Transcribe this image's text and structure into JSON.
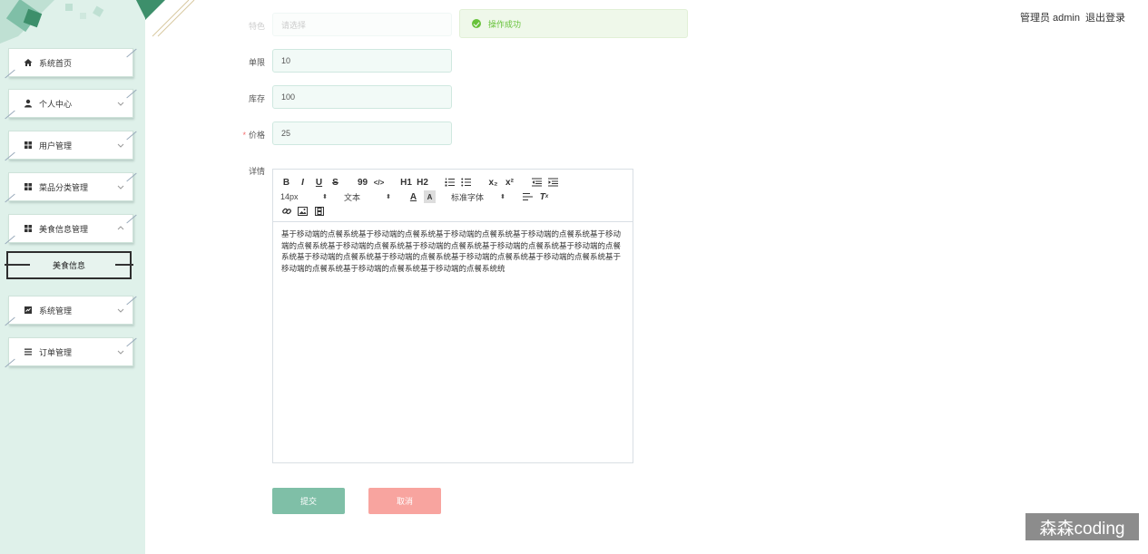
{
  "header": {
    "user_label": "管理员 admin",
    "logout_label": "退出登录"
  },
  "toast": {
    "message": "操作成功",
    "icon": "check-circle-icon",
    "color": "#67c23a"
  },
  "sidebar": {
    "items": [
      {
        "label": "系统首页",
        "icon": "home-icon"
      },
      {
        "label": "个人中心",
        "icon": "user-icon"
      },
      {
        "label": "用户管理",
        "icon": "grid-icon"
      },
      {
        "label": "菜品分类管理",
        "icon": "grid-icon"
      },
      {
        "label": "美食信息管理",
        "icon": "grid-icon",
        "expanded": true
      },
      {
        "label": "系统管理",
        "icon": "chart-icon"
      },
      {
        "label": "订单管理",
        "icon": "list-icon"
      }
    ],
    "active_sub": "美食信息"
  },
  "form": {
    "faded_field": {
      "label": "特色",
      "placeholder": "请选择"
    },
    "unit": {
      "label": "单限",
      "value": "10"
    },
    "stock": {
      "label": "库存",
      "value": "100"
    },
    "price": {
      "label": "价格",
      "value": "25",
      "required": "*"
    },
    "detail": {
      "label": "详情"
    }
  },
  "editor": {
    "toolbar_row1": [
      "B",
      "I",
      "U",
      "S",
      "99",
      "</>",
      "H1",
      "H2",
      "OL",
      "UL",
      "x₂",
      "x²",
      "outdent",
      "indent"
    ],
    "font_size": "14px",
    "paragraph": "文本",
    "font_family": "标准字体",
    "content": "基于移动端的点餐系统基于移动端的点餐系统基于移动端的点餐系统基于移动端的点餐系统基于移动端的点餐系统基于移动端的点餐系统基于移动端的点餐系统基于移动端的点餐系统基于移动端的点餐系统基于移动端的点餐系统基于移动端的点餐系统基于移动端的点餐系统基于移动端的点餐系统基于移动端的点餐系统基于移动端的点餐系统基于移动端的点餐系统统"
  },
  "buttons": {
    "submit": "提交",
    "cancel": "取消"
  },
  "watermark": "森森coding",
  "colors": {
    "sidebar_bg": "#dff1ea",
    "submit": "#7fbfa7",
    "cancel": "#f8a49f",
    "accent_green": "#3d8f6b"
  }
}
